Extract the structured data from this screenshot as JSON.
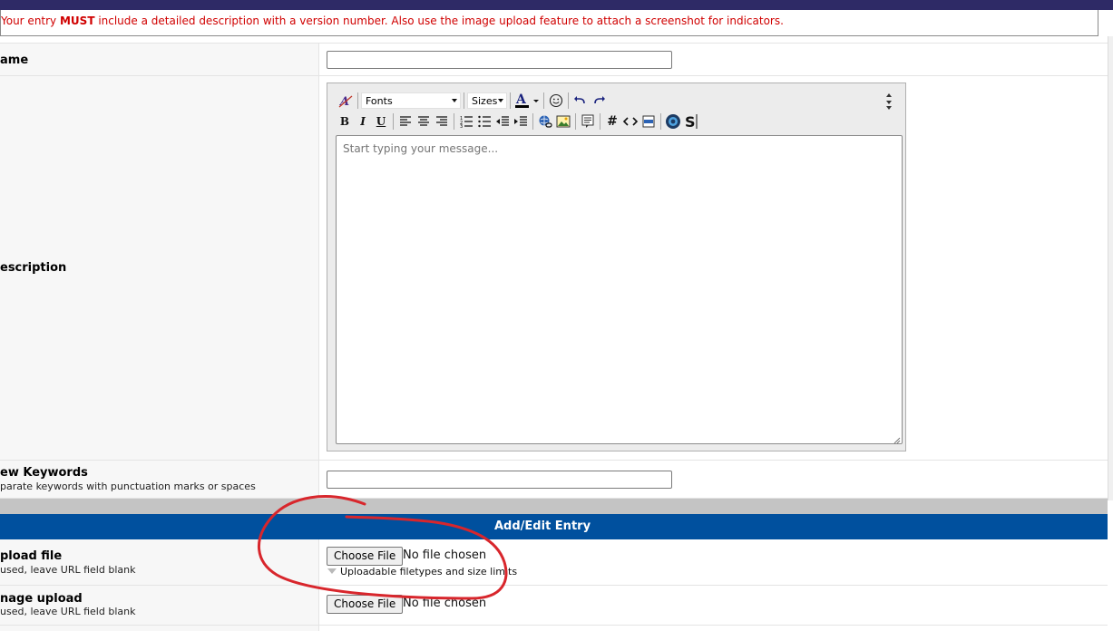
{
  "notice": {
    "prefix": "Your entry ",
    "must": "MUST",
    "suffix": " include a detailed description with a version number. Also use the image upload feature to attach a screenshot for indicators."
  },
  "name_row": {
    "label": "ame"
  },
  "description_row": {
    "label": "escription"
  },
  "editor": {
    "fonts_label": "Fonts",
    "sizes_label": "Sizes",
    "placeholder": "Start typing your message...",
    "toolbar_icons": [
      "font-style-icon",
      "text-color-icon",
      "smiley-icon",
      "undo-icon",
      "redo-icon",
      "bold-icon",
      "italic-icon",
      "underline-icon",
      "align-left-icon",
      "align-center-icon",
      "align-right-icon",
      "ordered-list-icon",
      "unordered-list-icon",
      "outdent-icon",
      "indent-icon",
      "link-icon",
      "image-icon",
      "quote-icon",
      "hash-icon",
      "code-icon",
      "php-icon",
      "source-icon",
      "strike-icon",
      "collapse-toolbar-icon"
    ]
  },
  "keywords_row": {
    "label": "ew Keywords",
    "sub": "parate keywords with punctuation marks or spaces"
  },
  "section_header": "Add/Edit Entry",
  "upload_row": {
    "label": "pload file",
    "sub": "used, leave URL field blank",
    "button": "Choose File",
    "status": "No file chosen",
    "limits": "Uploadable filetypes and size limits"
  },
  "image_row": {
    "label": "nage upload",
    "sub": "used, leave URL field blank",
    "button": "Choose File",
    "status": "No file chosen"
  },
  "colors": {
    "header_band": "#00509e",
    "notice_text": "#d00000",
    "annotation": "#d8262c",
    "top_bar": "#2e2a66"
  }
}
